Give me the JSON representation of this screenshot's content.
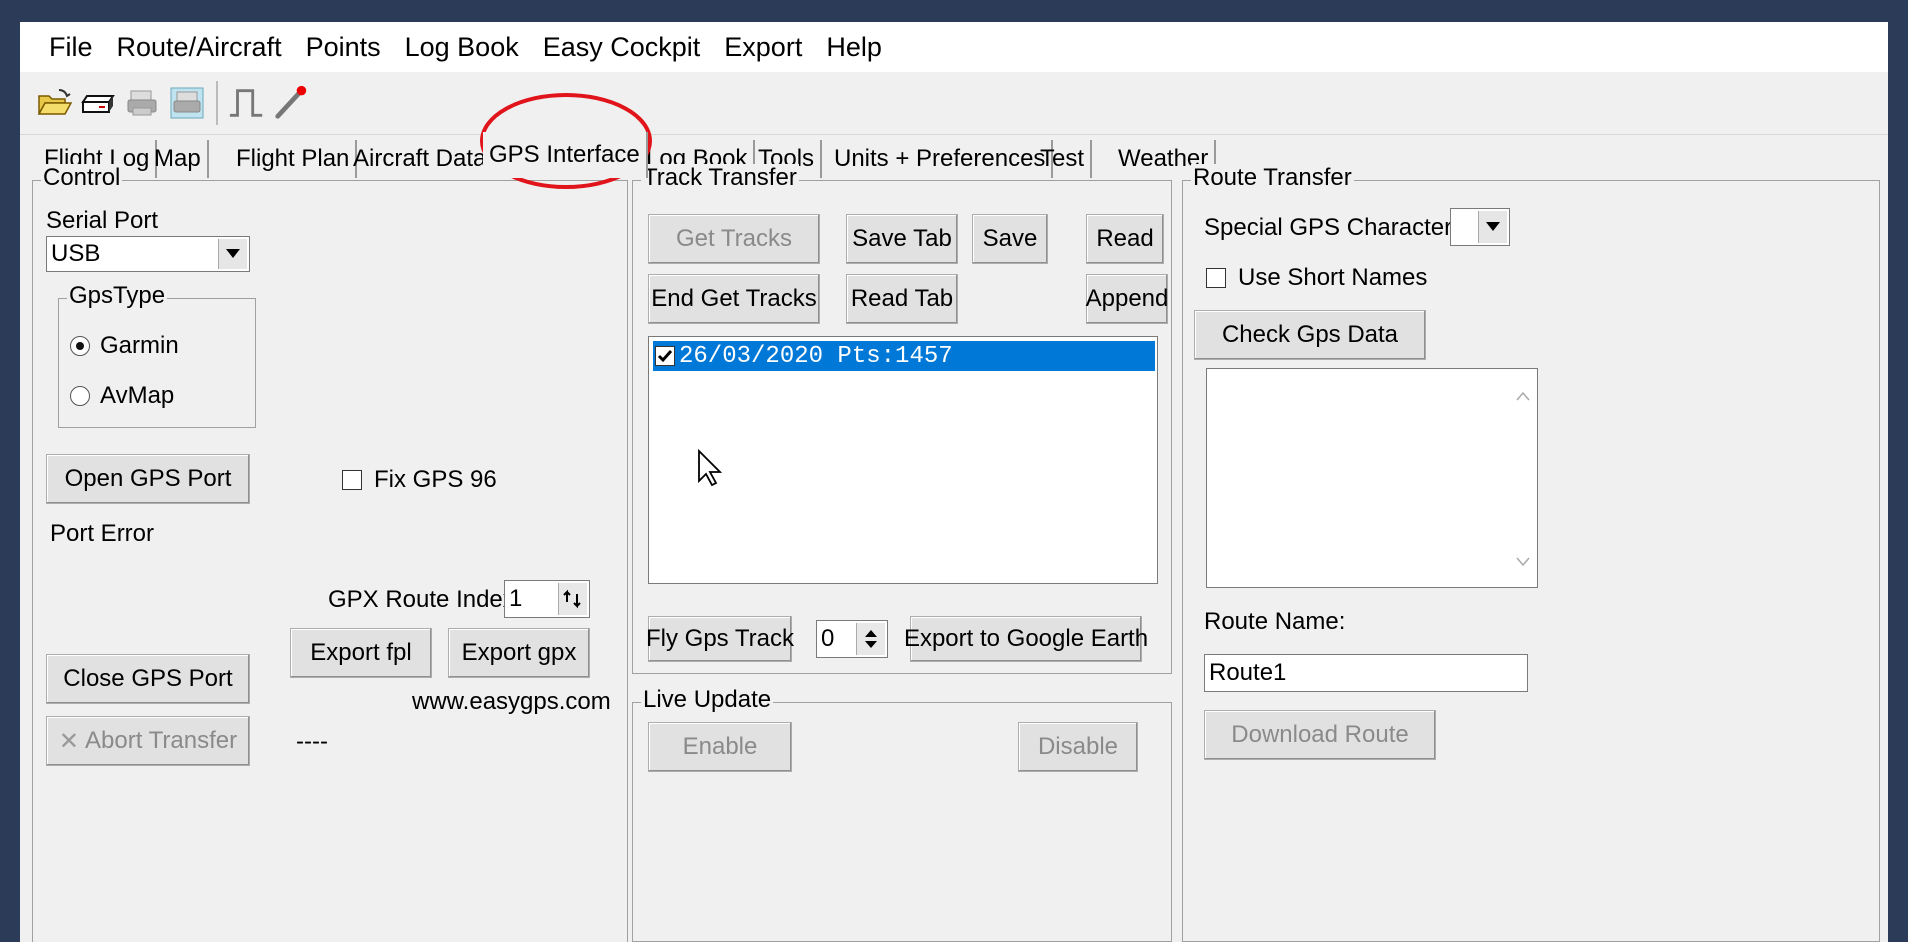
{
  "menu": [
    "File",
    "Route/Aircraft",
    "Points",
    "Log Book",
    "Easy Cockpit",
    "Export",
    "Help"
  ],
  "toolbar_icons": [
    "open-folder-icon",
    "drive-icon",
    "print-icon",
    "print-preview-icon",
    "pulse-icon",
    "pin-icon"
  ],
  "tabs": [
    "Flight Log",
    "Map",
    "Flight Plan",
    "Aircraft Data",
    "GPS Interface",
    "Log Book",
    "Tools",
    "Units + Preferences",
    "Test",
    "Weather"
  ],
  "active_tab": "GPS Interface",
  "control": {
    "title": "Control",
    "serial_port_label": "Serial Port",
    "serial_port_value": "USB",
    "gps_type_title": "GpsType",
    "gps_types": [
      "Garmin",
      "AvMap"
    ],
    "selected_gps_type": "Garmin",
    "open_port": "Open GPS Port",
    "fix_gps96": "Fix GPS 96",
    "fix_gps96_checked": false,
    "port_status": "Port Error",
    "gpx_route_index_label": "GPX Route Index:",
    "gpx_route_index_value": "1",
    "export_fpl": "Export fpl",
    "export_gpx": "Export gpx",
    "close_port": "Close GPS Port",
    "website": "www.easygps.com",
    "abort_transfer": "Abort Transfer",
    "status_dashes": "----"
  },
  "track_transfer": {
    "title": "Track Transfer",
    "get_tracks": "Get Tracks",
    "save_tab": "Save Tab",
    "save": "Save",
    "read": "Read",
    "end_get_tracks": "End Get Tracks",
    "read_tab": "Read Tab",
    "append": "Append",
    "tracks": [
      {
        "label": "26/03/2020 Pts:1457",
        "checked": true
      }
    ],
    "fly_gps_track": "Fly Gps Track",
    "track_number": "0",
    "export_google_earth": "Export to Google Earth"
  },
  "live_update": {
    "title": "Live Update",
    "enable": "Enable",
    "disable": "Disable"
  },
  "route_transfer": {
    "title": "Route Transfer",
    "special_char_label": "Special GPS Character:",
    "special_char_value": "",
    "use_short_names": "Use Short Names",
    "use_short_names_checked": false,
    "check_gps_data": "Check Gps Data",
    "route_name_label": "Route Name:",
    "route_name_value": "Route1",
    "download_route": "Download Route"
  },
  "colors": {
    "selection": "#0078d7",
    "annotation_circle": "#e0141a",
    "background": "#2c3b57"
  }
}
